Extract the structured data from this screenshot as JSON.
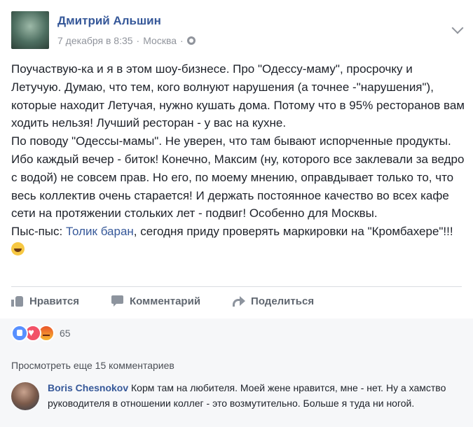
{
  "post": {
    "author": "Дмитрий Альшин",
    "date": "7 декабря в 8:35",
    "separator": "·",
    "location": "Москва",
    "text": {
      "line1": "Поучаствую-ка и я в этом шоу-бизнесе. Про \"Одессу-маму\", просрочку и Летучую. Думаю, что тем, кого волнуют нарушения (а точнее -\"нарушения\"), которые находит Летучая, нужно кушать дома. Потому что в 95% ресторанов вам ходить нельзя! Лучший ресторан - у вас на кухне.",
      "line2": "По поводу \"Одессы-мамы\". Не уверен, что там бывают испорченные продукты. Ибо каждый вечер - биток! Конечно, Максим (ну, которого все заклевали за ведро с водой) не совсем прав. Но его, по моему мнению, оправдывает только то, что весь коллектив очень старается! И держать постоянное качество во всех кафе сети на протяжении стольких лет - подвиг! Особенно для Москвы.",
      "line3_prefix": "Пыс-пыс: ",
      "line3_mention": "Толик баран",
      "line3_suffix": ", сегодня приду проверять маркировки на \"Кромбахере\"!!! "
    }
  },
  "actions": {
    "like": "Нравится",
    "comment": "Комментарий",
    "share": "Поделиться"
  },
  "reactions": {
    "count": "65",
    "types": [
      "like-icon",
      "love-icon",
      "angry-icon"
    ]
  },
  "comments": {
    "view_more": "Просмотреть еще 15 комментариев",
    "items": [
      {
        "author": "Boris Chesnokov",
        "text": " Корм там на любителя. Моей жене нравится, мне - нет. Ну а хамство руководителя в отношении коллег - это возмутительно. Больше я туда ни ногой."
      }
    ]
  },
  "colors": {
    "link": "#365899",
    "meta": "#90949c",
    "like_reaction": "#5890ff",
    "love_reaction": "#f25268"
  }
}
